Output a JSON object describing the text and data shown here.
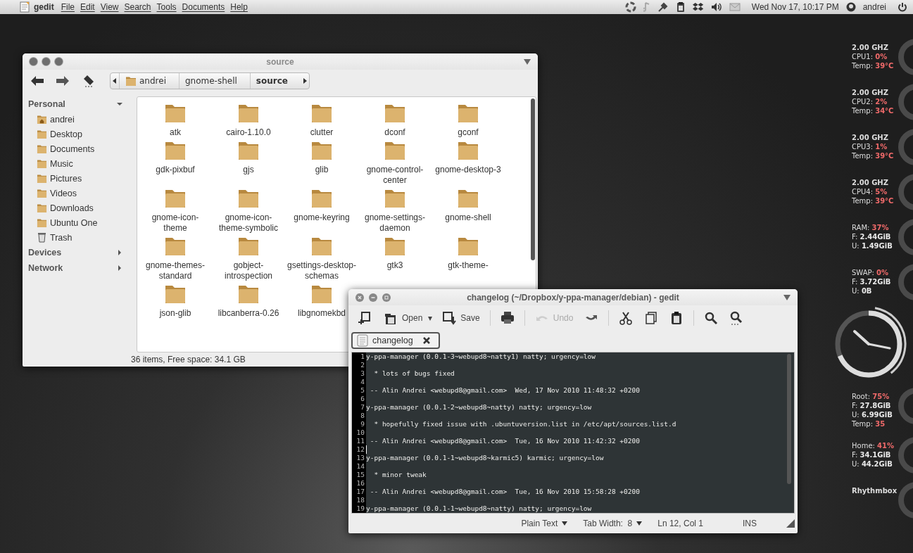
{
  "panel": {
    "app": "gedit",
    "menus": [
      "File",
      "Edit",
      "View",
      "Search",
      "Tools",
      "Documents",
      "Help"
    ],
    "clock": "Wed Nov 17, 10:17 PM",
    "user": "andrei"
  },
  "file_manager": {
    "title": "source",
    "breadcrumbs": [
      {
        "label": "andrei",
        "selected": false
      },
      {
        "label": "gnome-shell",
        "selected": false
      },
      {
        "label": "source",
        "selected": true
      }
    ],
    "sidebar": [
      {
        "title": "Personal",
        "expanded": true,
        "items": [
          {
            "label": "andrei",
            "kind": "home"
          },
          {
            "label": "Desktop",
            "kind": "folder"
          },
          {
            "label": "Documents",
            "kind": "folder"
          },
          {
            "label": "Music",
            "kind": "folder"
          },
          {
            "label": "Pictures",
            "kind": "folder"
          },
          {
            "label": "Videos",
            "kind": "folder"
          },
          {
            "label": "Downloads",
            "kind": "folder"
          },
          {
            "label": "Ubuntu One",
            "kind": "folder"
          },
          {
            "label": "Trash",
            "kind": "trash"
          }
        ]
      },
      {
        "title": "Devices",
        "expanded": false
      },
      {
        "title": "Network",
        "expanded": false
      }
    ],
    "files": [
      "atk",
      "cairo-1.10.0",
      "clutter",
      "dconf",
      "gconf",
      "gdk-pixbuf",
      "gjs",
      "glib",
      "gnome-control-center",
      "gnome-desktop-3",
      "gnome-icon-theme",
      "gnome-icon-theme-symbolic",
      "gnome-keyring",
      "gnome-settings-daemon",
      "gnome-shell",
      "gnome-themes-standard",
      "gobject-introspection",
      "gsettings-desktop-schemas",
      "gtk3",
      "gtk-theme-",
      "json-glib",
      "libcanberra-0.26",
      "libgnomekbd"
    ],
    "status": "36 items, Free space: 34.1 GB"
  },
  "gedit": {
    "title": "changelog (~/Dropbox/y-ppa-manager/debian) - gedit",
    "toolbar": [
      {
        "kind": "button",
        "disabled": false
      },
      {
        "kind": "button",
        "label": "Open",
        "disabled": false
      },
      {
        "kind": "dropdown",
        "label": "▾",
        "disabled": false
      },
      {
        "kind": "button",
        "label": "Save",
        "disabled": false
      },
      {
        "kind": "separator"
      },
      {
        "kind": "button",
        "disabled": false
      },
      {
        "kind": "separator"
      },
      {
        "kind": "button",
        "label": "Undo",
        "disabled": true
      },
      {
        "kind": "button",
        "disabled": false
      },
      {
        "kind": "separator"
      },
      {
        "kind": "button",
        "disabled": false
      },
      {
        "kind": "button",
        "disabled": false
      },
      {
        "kind": "button",
        "disabled": false
      },
      {
        "kind": "separator"
      },
      {
        "kind": "button",
        "disabled": false
      },
      {
        "kind": "button",
        "disabled": false
      }
    ],
    "tabs": [
      {
        "label": "changelog",
        "selected": true
      }
    ],
    "lines": [
      {
        "no": "1",
        "text": "y-ppa-manager (0.0.1-3~webupd8~natty1) natty; urgency=low",
        "cursor": false
      },
      {
        "no": "2",
        "cursor": false
      },
      {
        "no": "3",
        "text": "  * lots of bugs fixed",
        "cursor": false
      },
      {
        "no": "4",
        "cursor": false
      },
      {
        "no": "5",
        "text": " -- Alin Andrei <webupd8@gmail.com>  Wed, 17 Nov 2010 11:48:32 +0200",
        "cursor": false
      },
      {
        "no": "6",
        "cursor": false
      },
      {
        "no": "7",
        "text": "y-ppa-manager (0.0.1-2~webupd8~natty) natty; urgency=low",
        "cursor": false
      },
      {
        "no": "8",
        "cursor": false
      },
      {
        "no": "9",
        "text": "  * hopefully fixed issue with .ubuntuversion.list in /etc/apt/sources.list.d",
        "cursor": false
      },
      {
        "no": "10",
        "cursor": false
      },
      {
        "no": "11",
        "text": " -- Alin Andrei <webupd8@gmail.com>  Tue, 16 Nov 2010 11:42:32 +0200",
        "cursor": false
      },
      {
        "no": "12",
        "cursor": true
      },
      {
        "no": "13",
        "text": "y-ppa-manager (0.0.1-1~webupd8~karmic5) karmic; urgency=low",
        "cursor": false
      },
      {
        "no": "14",
        "cursor": false
      },
      {
        "no": "15",
        "text": "  * minor tweak",
        "cursor": false
      },
      {
        "no": "16",
        "cursor": false
      },
      {
        "no": "17",
        "text": " -- Alin Andrei <webupd8@gmail.com>  Tue, 16 Nov 2010 15:58:28 +0200",
        "cursor": false
      },
      {
        "no": "18",
        "cursor": false
      },
      {
        "no": "19",
        "text": "y-ppa-manager (0.0.1-1~webupd8~natty) natty; urgency=low",
        "cursor": false
      }
    ],
    "status": {
      "language": "Plain Text",
      "tab_width": "Tab Width:  8",
      "position": "Ln 12, Col 1",
      "mode": "INS"
    }
  },
  "conky": [
    {
      "kind": "stats",
      "lines": [
        {
          "kind": "heading",
          "label": "2.00 GHZ"
        },
        {
          "kind": "pair",
          "label": "CPU1:",
          "value": "0%",
          "alert": true
        },
        {
          "kind": "pair",
          "label": "Temp:",
          "value": "39°C",
          "alert": true
        }
      ]
    },
    {
      "kind": "stats",
      "lines": [
        {
          "kind": "heading",
          "label": "2.00 GHZ"
        },
        {
          "kind": "pair",
          "label": "CPU2:",
          "value": "2%",
          "alert": true
        },
        {
          "kind": "pair",
          "label": "Temp:",
          "value": "34°C",
          "alert": true
        }
      ]
    },
    {
      "kind": "stats",
      "lines": [
        {
          "kind": "heading",
          "label": "2.00 GHZ"
        },
        {
          "kind": "pair",
          "label": "CPU3:",
          "value": "1%",
          "alert": true
        },
        {
          "kind": "pair",
          "label": "Temp:",
          "value": "39°C",
          "alert": true
        }
      ]
    },
    {
      "kind": "stats",
      "lines": [
        {
          "kind": "heading",
          "label": "2.00 GHZ"
        },
        {
          "kind": "pair",
          "label": "CPU4:",
          "value": "5%",
          "alert": true
        },
        {
          "kind": "pair",
          "label": "Temp:",
          "value": "39°C",
          "alert": true
        }
      ]
    },
    {
      "kind": "stats",
      "lines": [
        {
          "kind": "pair",
          "label": "RAM:",
          "value": "37%",
          "alert": true
        },
        {
          "kind": "pair",
          "label": "F:",
          "value": "2.44GiB",
          "alert": false
        },
        {
          "kind": "pair",
          "label": "U:",
          "value": "1.49GiB",
          "alert": false
        }
      ]
    },
    {
      "kind": "stats",
      "lines": [
        {
          "kind": "pair",
          "label": "SWAP:",
          "value": "0%",
          "alert": true
        },
        {
          "kind": "pair",
          "label": "F:",
          "value": "3.72GiB",
          "alert": false
        },
        {
          "kind": "pair",
          "label": "U:",
          "value": "0B",
          "alert": false
        }
      ]
    },
    {
      "kind": "clock"
    },
    {
      "kind": "stats",
      "lines": [
        {
          "kind": "pair",
          "label": "Root:",
          "value": "75%",
          "alert": true
        },
        {
          "kind": "pair",
          "label": "F:",
          "value": "27.8GiB",
          "alert": false
        },
        {
          "kind": "pair",
          "label": "U:",
          "value": "6.99GiB",
          "alert": false
        },
        {
          "kind": "pair",
          "label": "Temp:",
          "value": "35",
          "alert": true
        }
      ]
    },
    {
      "kind": "stats",
      "lines": [
        {
          "kind": "pair",
          "label": "Home:",
          "value": "41%",
          "alert": true
        },
        {
          "kind": "pair",
          "label": "F:",
          "value": "34.1GiB",
          "alert": false
        },
        {
          "kind": "pair",
          "label": "U:",
          "value": "44.2GiB",
          "alert": false
        }
      ]
    },
    {
      "kind": "stats",
      "lines": [
        {
          "kind": "heading",
          "label": "Rhythmbox"
        }
      ]
    }
  ]
}
